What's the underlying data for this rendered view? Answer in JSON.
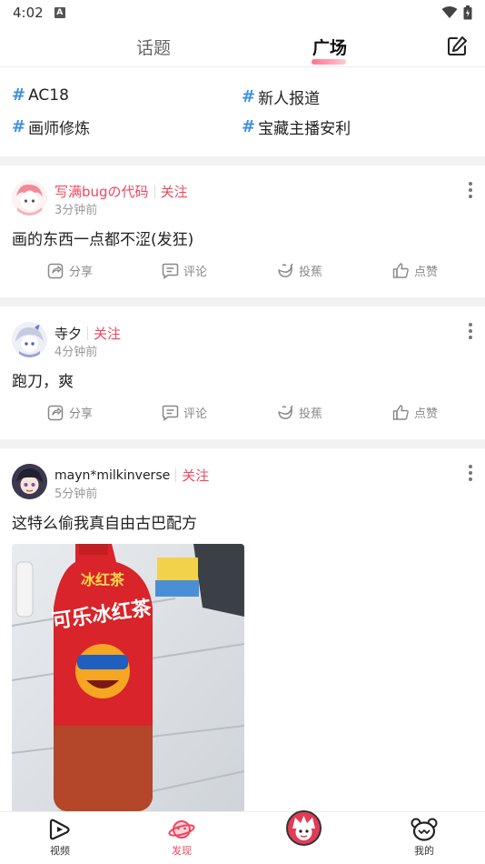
{
  "status": {
    "time": "4:02",
    "notice": "A"
  },
  "nav": {
    "tab_topic": "话题",
    "tab_square": "广场"
  },
  "topics": [
    {
      "hash": "#",
      "label": "AC18"
    },
    {
      "hash": "#",
      "label": "新人报道"
    },
    {
      "hash": "#",
      "label": "画师修炼"
    },
    {
      "hash": "#",
      "label": "宝藏主播安利"
    }
  ],
  "posts": [
    {
      "user": "写满bugの代码",
      "follow": "关注",
      "time": "3分钟前",
      "content": "画的东西一点都不涩(发狂)"
    },
    {
      "user": "寺夕",
      "follow": "关注",
      "time": "4分钟前",
      "content": "跑刀，爽"
    },
    {
      "user": "mayn*milkinverse",
      "follow": "关注",
      "time": "5分钟前",
      "content": "这特么偷我真自由古巴配方",
      "photo_text": {
        "brand": "冰红茶",
        "main": "可乐冰红茶"
      }
    }
  ],
  "actions": {
    "share": "分享",
    "comment": "评论",
    "vote": "投蕉",
    "like": "点赞"
  },
  "bottom_nav": {
    "video": "视频",
    "discover": "发现",
    "mine": "我的"
  },
  "colors": {
    "accent": "#f0475f",
    "hashtag": "#3d8fe0"
  }
}
